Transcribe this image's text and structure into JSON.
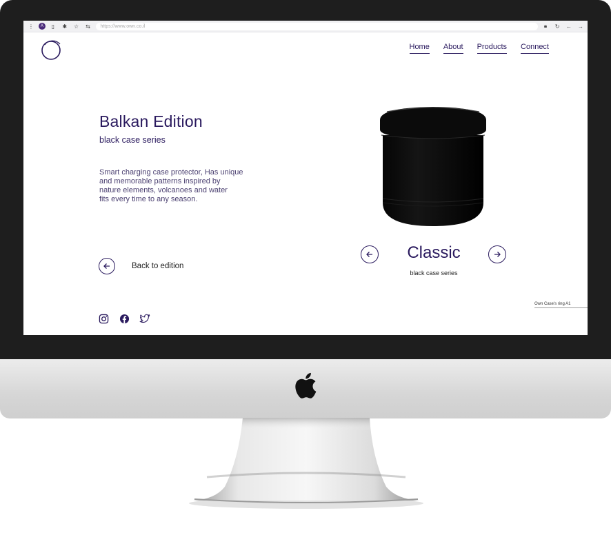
{
  "browser": {
    "url": "https://www.own.co.il",
    "avatar_letter": "A"
  },
  "nav": {
    "items": [
      "Home",
      "About",
      "Products",
      "Connect"
    ]
  },
  "hero": {
    "title": "Balkan Edition",
    "subtitle": "black case series",
    "description": [
      "Smart charging case protector, Has unique",
      "and memorable patterns inspired by",
      "nature elements, volcanoes and water",
      "fits every time to any season."
    ],
    "back_label": "Back to edition"
  },
  "product": {
    "name": "Classic",
    "subtitle": "black case series",
    "caption": "Own Case's ring A1"
  },
  "colors": {
    "accent": "#2a1a5e",
    "bezel": "#1e1e1e"
  },
  "icons": {
    "social": [
      "instagram-icon",
      "facebook-icon",
      "twitter-icon"
    ]
  }
}
